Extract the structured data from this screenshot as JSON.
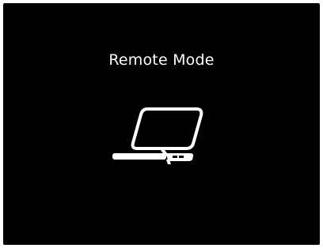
{
  "screen": {
    "title": "Remote Mode",
    "icon": "laptop-icon",
    "background_color": "#000000",
    "text_color": "#ffffff"
  }
}
